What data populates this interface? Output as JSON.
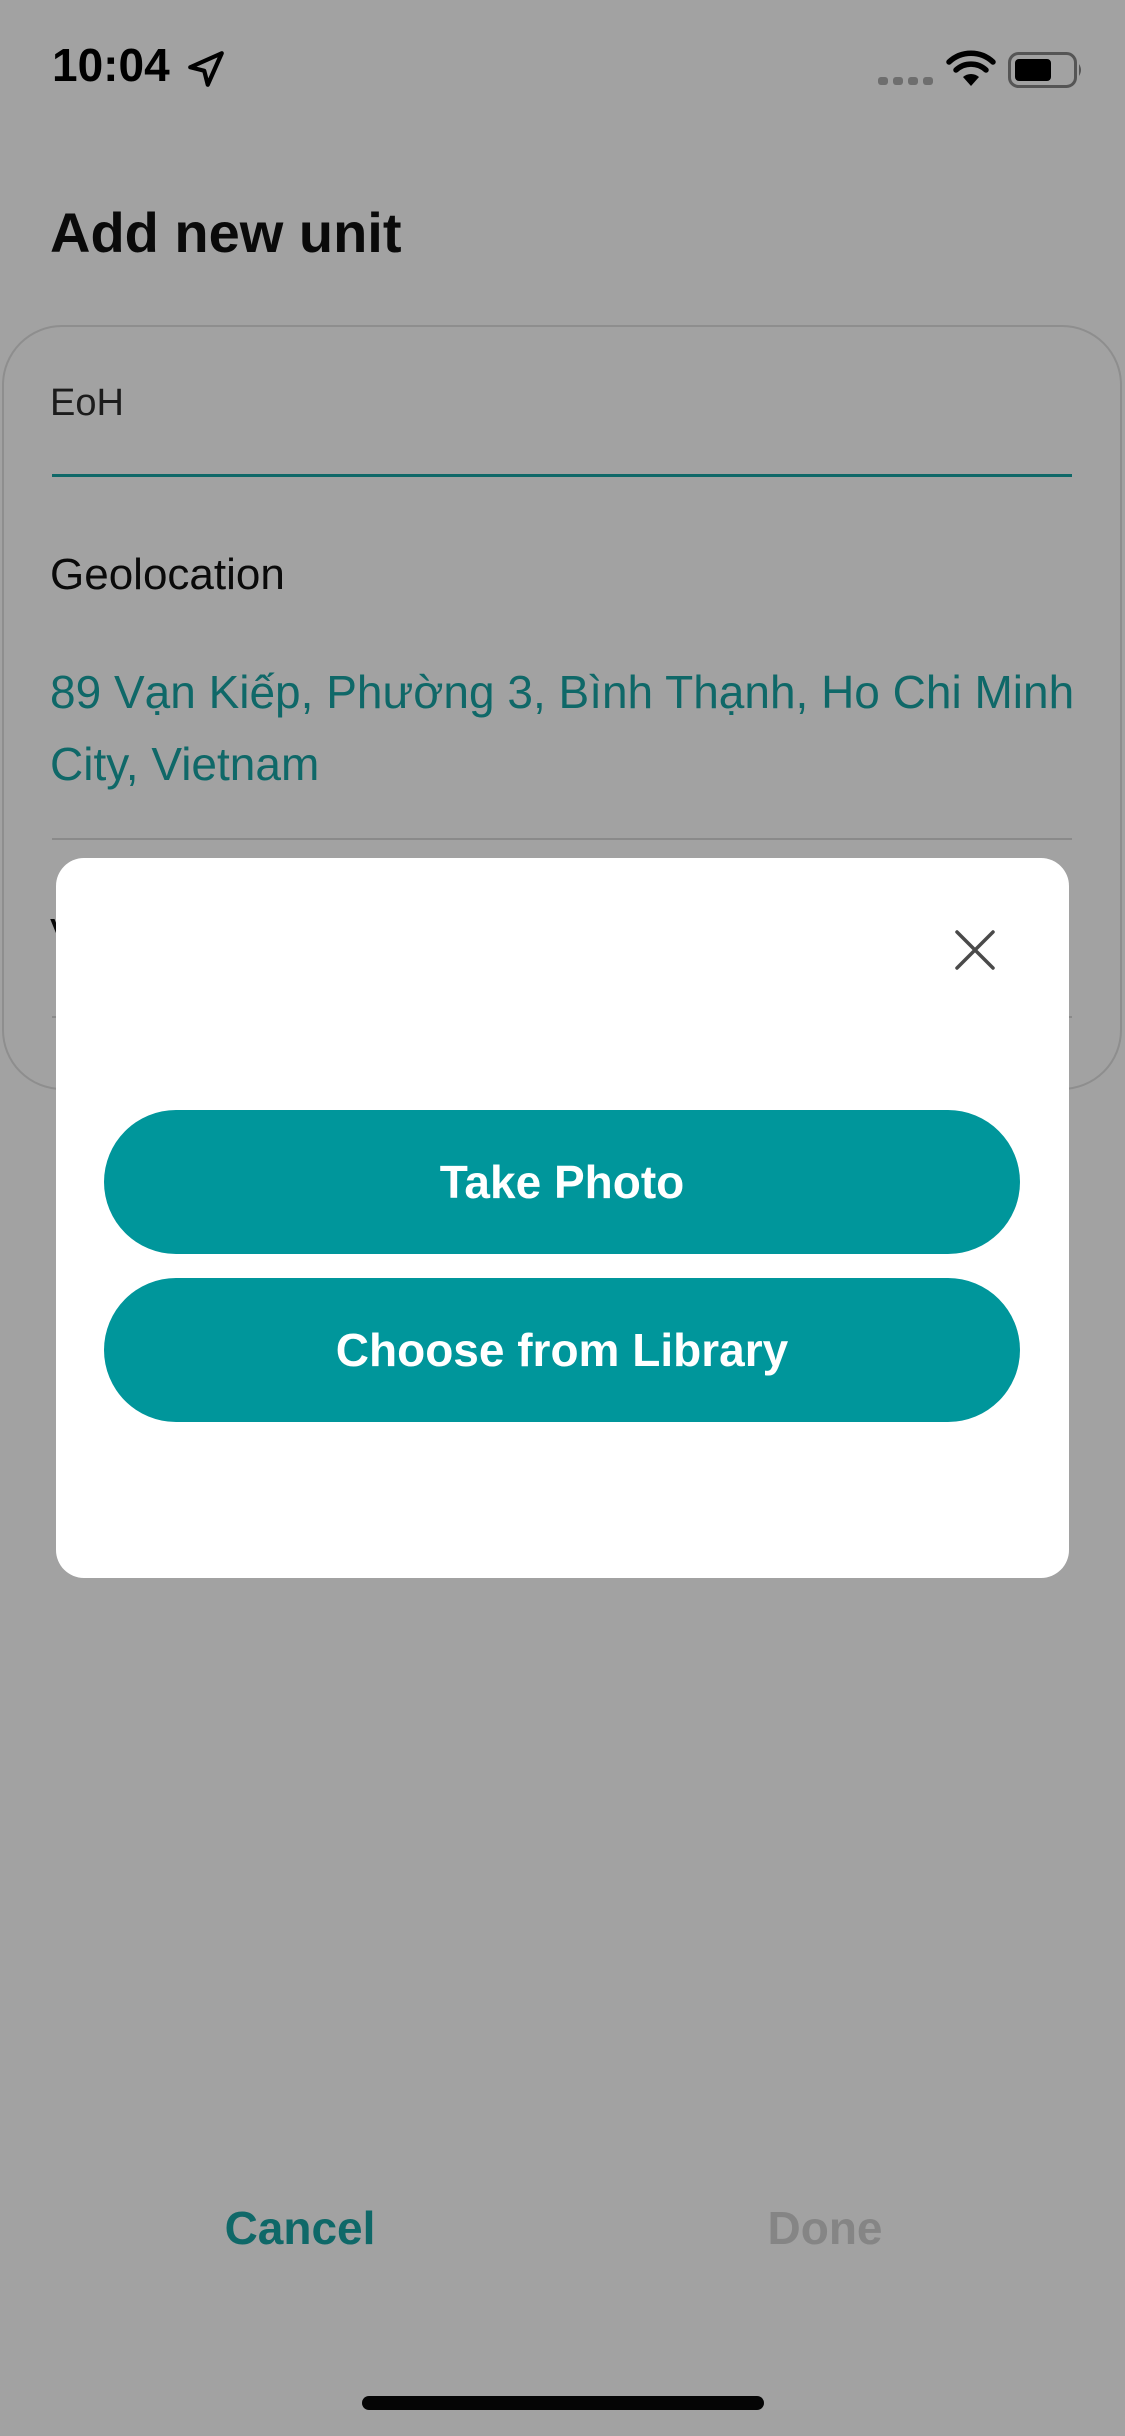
{
  "status_bar": {
    "time": "10:04",
    "icons": [
      "location-arrow-icon",
      "signal-icon",
      "wifi-icon",
      "battery-icon"
    ]
  },
  "header": {
    "title": "Add new unit"
  },
  "form": {
    "name_value": "EoH",
    "geolocation_label": "Geolocation",
    "geolocation_address": "89 Vạn Kiếp, Phường 3, Bình Thạnh, Ho Chi Minh City, Vietnam",
    "row3_partial_label": "V"
  },
  "modal": {
    "close_icon": "close-icon",
    "take_photo_label": "Take Photo",
    "choose_library_label": "Choose from Library"
  },
  "footer": {
    "cancel_label": "Cancel",
    "done_label": "Done"
  },
  "colors": {
    "accent": "#00969b",
    "link": "#0f6868",
    "overlay": "#a2a2a2",
    "disabled": "#858585"
  }
}
